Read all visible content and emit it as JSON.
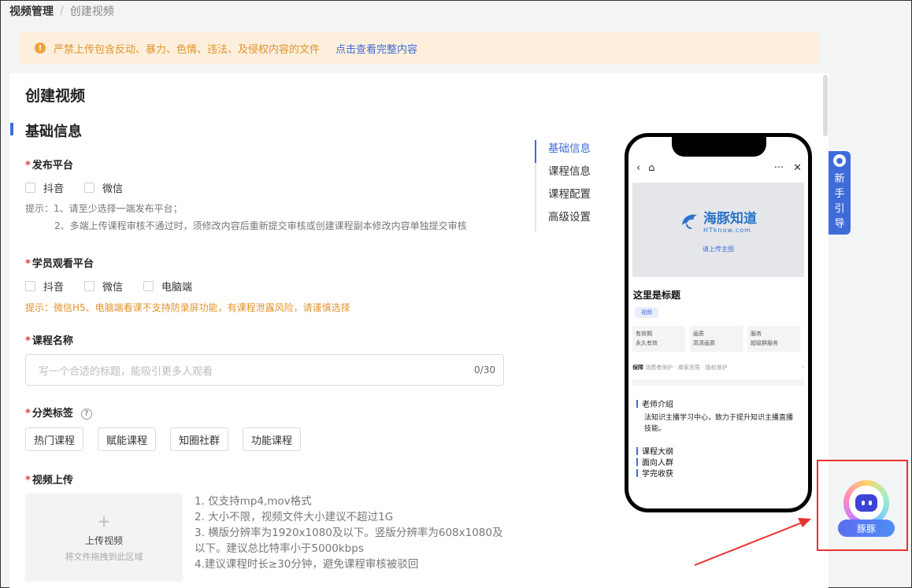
{
  "breadcrumb": {
    "parent": "视频管理",
    "separator": "/",
    "current": "创建视频"
  },
  "notice": {
    "text": "严禁上传包含反动、暴力、色情、违法、及侵权内容的文件",
    "link": "点击查看完整内容"
  },
  "page_title": "创建视频",
  "section_title": "基础信息",
  "publish_platform": {
    "label": "发布平台",
    "options": [
      "抖音",
      "微信"
    ],
    "hint_line1": "提示：1、请至少选择一端发布平台；",
    "hint_line2": "2、多端上传课程审核不通过时，须修改内容后重新提交审核或创建课程副本修改内容单独提交审核"
  },
  "watch_platform": {
    "label": "学员观看平台",
    "options": [
      "抖音",
      "微信",
      "电脑端"
    ],
    "warning": "提示：微信H5、电脑端看课不支持防录屏功能，有课程泄露风险，请谨慎选择"
  },
  "course_name": {
    "label": "课程名称",
    "placeholder": "写一个合适的标题，能吸引更多人观看",
    "count": "0/30"
  },
  "category": {
    "label": "分类标签",
    "help": "?",
    "tags": [
      "热门课程",
      "赋能课程",
      "知圈社群",
      "功能课程"
    ]
  },
  "video_upload": {
    "label": "视频上传",
    "plus": "+",
    "button": "上传视频",
    "drop_hint": "将文件拖拽到此区域",
    "requirements": [
      "1. 仅支持mp4,mov格式",
      "2. 大小不限，视频文件大小建议不超过1G",
      "3. 横版分辨率为1920x1080及以下。竖版分辨率为608x1080及以下。建议总比特率小于5000kbps",
      "4.建议课程时长≥30分钟，避免课程审核被驳回"
    ]
  },
  "anchor_nav": [
    "基础信息",
    "课程信息",
    "课程配置",
    "高级设置"
  ],
  "phone": {
    "nav_back": "‹",
    "nav_home": "⌂",
    "nav_more": "···",
    "nav_close": "✕",
    "logo": "海豚知道",
    "logo_sub": "HTknow.com",
    "upload_hint": "请上传主图",
    "title": "这里是标题",
    "chip": "视频",
    "boxes": [
      {
        "label": "有效期",
        "value": "永久有效"
      },
      {
        "label": "画质",
        "value": "高清画质"
      },
      {
        "label": "服务",
        "value": "超级群服务"
      }
    ],
    "guard_label": "保障",
    "guard_text": "消费者保护 · 商家资质 · 版权保护",
    "guard_arrow": "›",
    "teacher_title": "老师介绍",
    "teacher_text": "法知识主播学习中心，致力于提升知识主播直播技能。",
    "sections": [
      "课程大纲",
      "面向人群",
      "学完收获"
    ]
  },
  "guide": {
    "text": "新手引导"
  },
  "assistant": {
    "label": "豚豚"
  },
  "colors": {
    "accent": "#3f6bd9",
    "warning_bg": "#fdefdc",
    "warning_text": "#e0932b",
    "required": "#e23b3b",
    "highlight": "#e8322f"
  }
}
